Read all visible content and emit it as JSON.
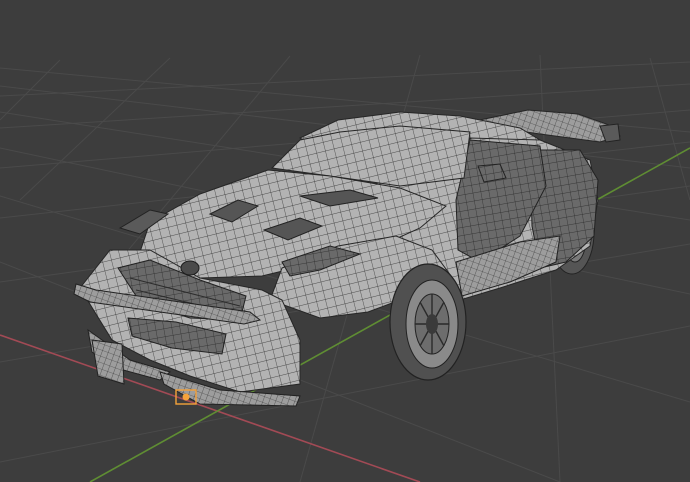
{
  "viewport": {
    "mode": "3D viewport",
    "shading": "solid",
    "overlay": "wireframe",
    "background_color": "#3d3d3d",
    "grid_color": "#4a4a4a",
    "x_axis_color": "#a24a55",
    "y_axis_color": "#5f8d33",
    "mesh_face_color": "#b3b3b3",
    "mesh_dark_color": "#5a5a5a",
    "mesh_wire_color": "#262626",
    "origin_marker_color": "#f4a23a"
  },
  "scene": {
    "object": "car-mesh",
    "parts": [
      "body-shell",
      "roof",
      "windshield",
      "hood",
      "hood-vents",
      "grille",
      "badge",
      "front-splitter",
      "front-bumper",
      "headlight",
      "front-fender",
      "side-skirt",
      "side-mirror",
      "rear-spoiler",
      "rear-fender",
      "front-wheel",
      "rear-wheel",
      "origin-point"
    ]
  }
}
